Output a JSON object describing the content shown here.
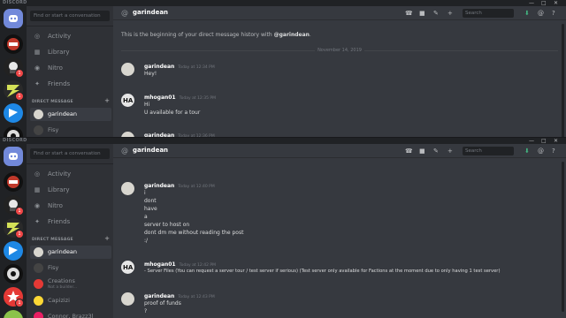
{
  "brand": "DISCORD",
  "window_controls": [
    "—",
    "□",
    "✕"
  ],
  "search_conversation_placeholder": "Find or start a conversation",
  "nav": [
    {
      "label": "Activity",
      "icon": "activity-icon"
    },
    {
      "label": "Library",
      "icon": "library-icon"
    },
    {
      "label": "Nitro",
      "icon": "nitro-icon"
    },
    {
      "label": "Friends",
      "icon": "friends-icon"
    }
  ],
  "direct_messages_header": "DIRECT MESSAGE",
  "guild_badges": [
    "1",
    "1",
    "1"
  ],
  "top": {
    "dms": [
      {
        "name": "garindean",
        "active": true
      },
      {
        "name": "Fisy",
        "active": false
      }
    ],
    "channel": "garindean",
    "search_placeholder": "Search",
    "history_prefix": "This is the beginning of your direct message history with ",
    "history_user": "@garindean",
    "history_suffix": ".",
    "date_divider": "November 14, 2019",
    "messages": [
      {
        "author": "garindean",
        "time": "Today at 12:34 PM",
        "lines": [
          "Hey!"
        ]
      },
      {
        "author": "mhogan01",
        "time": "Today at 12:35 PM",
        "lines": [
          "Hi",
          "U available for a tour"
        ]
      },
      {
        "author": "garindean",
        "time": "Today at 12:36 PM",
        "lines": []
      }
    ]
  },
  "bottom": {
    "dms": [
      {
        "name": "garindean",
        "active": true
      },
      {
        "name": "Fisy",
        "active": false
      },
      {
        "name": "Creations",
        "sub": "Not a builder...",
        "active": false
      },
      {
        "name": "Capizizi",
        "active": false
      },
      {
        "name": "Connor, Brazz3l",
        "active": false
      }
    ],
    "channel": "garindean",
    "search_placeholder": "Search",
    "messages": [
      {
        "author": "garindean",
        "time": "Today at 12:40 PM",
        "lines": [
          "i",
          "dont",
          "have",
          "a",
          "server to host on",
          "dont dm me without reading the post",
          ":/"
        ]
      },
      {
        "author": "mhogan01",
        "time": "Today at 12:42 PM",
        "lines": [
          "- Server Files (You can request a server tour / test server if serious) (Test server only available for Factions at the moment due to only having 1 test server)"
        ]
      },
      {
        "author": "garindean",
        "time": "Today at 12:43 PM",
        "lines": [
          "proof of funds",
          "?"
        ]
      }
    ]
  },
  "colors": {
    "blurple": "#7289da",
    "badge": "#f04747",
    "online": "#43b581"
  }
}
